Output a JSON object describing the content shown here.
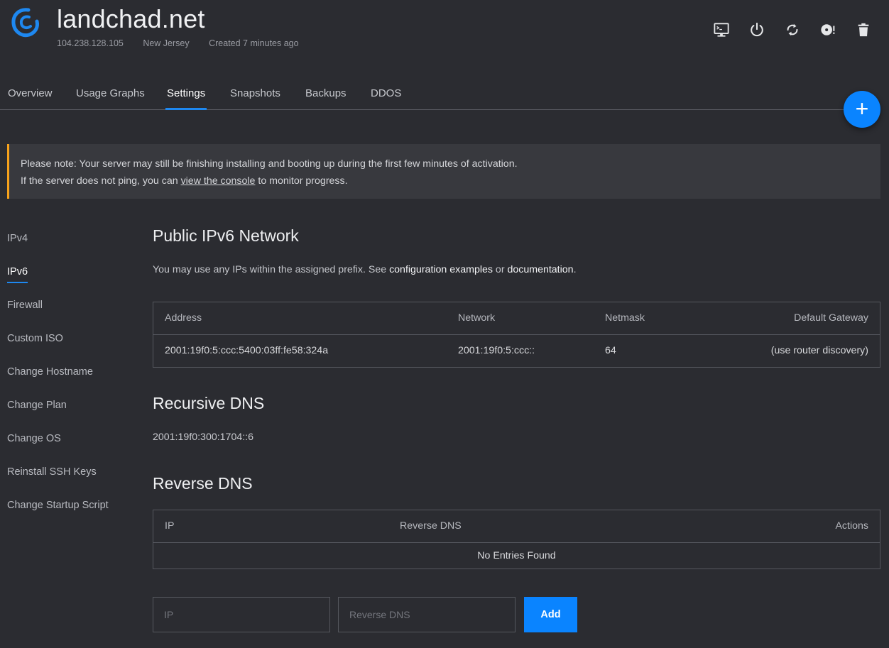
{
  "server": {
    "name": "landchad.net",
    "ip": "104.238.128.105",
    "location": "New Jersey",
    "created": "Created 7 minutes ago"
  },
  "header_actions": [
    {
      "icon": "console-icon"
    },
    {
      "icon": "power-icon"
    },
    {
      "icon": "restart-icon"
    },
    {
      "icon": "iso-disc-icon"
    },
    {
      "icon": "trash-icon"
    }
  ],
  "tabs": [
    "Overview",
    "Usage Graphs",
    "Settings",
    "Snapshots",
    "Backups",
    "DDOS"
  ],
  "active_tab": "Settings",
  "fab_label": "+",
  "notice": {
    "line1": "Please note: Your server may still be finishing installing and booting up during the first few minutes of activation.",
    "line2_prefix": "If the server does not ping, you can ",
    "line2_link": "view the console",
    "line2_suffix": " to monitor progress."
  },
  "sidenav": [
    "IPv4",
    "IPv6",
    "Firewall",
    "Custom ISO",
    "Change Hostname",
    "Change Plan",
    "Change OS",
    "Reinstall SSH Keys",
    "Change Startup Script"
  ],
  "active_sidenav": "IPv6",
  "ipv6": {
    "heading": "Public IPv6 Network",
    "desc_prefix": "You may use any IPs within the assigned prefix. See ",
    "link1": "configuration examples",
    "desc_mid": " or ",
    "link2": "documentation",
    "desc_suffix": ".",
    "headers": {
      "address": "Address",
      "network": "Network",
      "netmask": "Netmask",
      "gateway": "Default Gateway"
    },
    "row": {
      "address": "2001:19f0:5:ccc:5400:03ff:fe58:324a",
      "network": "2001:19f0:5:ccc::",
      "netmask": "64",
      "gateway": "(use router discovery)"
    }
  },
  "recursive_dns": {
    "heading": "Recursive DNS",
    "value": "2001:19f0:300:1704::6"
  },
  "reverse_dns": {
    "heading": "Reverse DNS",
    "headers": {
      "ip": "IP",
      "rdns": "Reverse DNS",
      "actions": "Actions"
    },
    "empty": "No Entries Found",
    "ip_placeholder": "IP",
    "rdns_placeholder": "Reverse DNS",
    "add_label": "Add"
  },
  "colors": {
    "accent": "#0a84ff",
    "warning": "#f7a21b",
    "background": "#2b2c31"
  }
}
